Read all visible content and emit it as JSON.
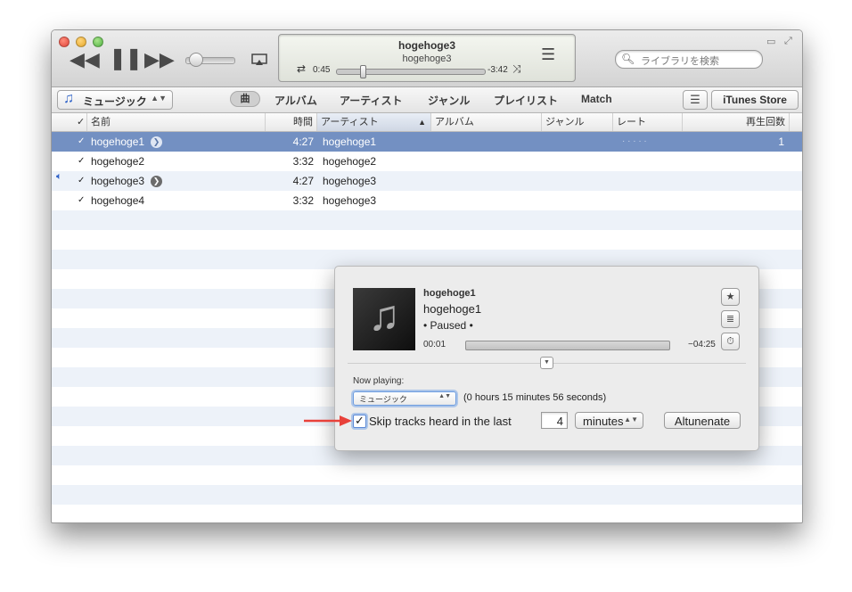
{
  "player": {
    "now_title": "hogehoge3",
    "now_artist": "hogehoge3",
    "elapsed": "0:45",
    "remaining": "-3:42",
    "progress": 0.18,
    "volume": 0.15
  },
  "search": {
    "placeholder": "ライブラリを検索"
  },
  "nav": {
    "library": "ミュージック",
    "songs_pill": "曲",
    "items": [
      "アルバム",
      "アーティスト",
      "ジャンル",
      "プレイリスト",
      "Match"
    ],
    "store": "iTunes Store"
  },
  "columns": {
    "check": "✓",
    "name": "名前",
    "time": "時間",
    "artist": "アーティスト",
    "album": "アルバム",
    "genre": "ジャンル",
    "rating": "レート",
    "plays": "再生回数"
  },
  "tracks": [
    {
      "name": "hogehoge1",
      "time": "4:27",
      "artist": "hogehoge1",
      "rating": "· · · · ·",
      "plays": "1"
    },
    {
      "name": "hogehoge2",
      "time": "3:32",
      "artist": "hogehoge2",
      "rating": "",
      "plays": ""
    },
    {
      "name": "hogehoge3",
      "time": "4:27",
      "artist": "hogehoge3",
      "rating": "",
      "plays": ""
    },
    {
      "name": "hogehoge4",
      "time": "3:32",
      "artist": "hogehoge3",
      "rating": "",
      "plays": ""
    }
  ],
  "popup": {
    "title": "hogehoge1",
    "artist": "hogehoge1",
    "state": "• Paused •",
    "elapsed": "00:01",
    "remaining": "−04:25",
    "progress": 0.0,
    "now_playing_label": "Now playing:",
    "playlist": "ミュージック",
    "duration": "(0 hours 15 minutes 56 seconds)",
    "skip_label": "Skip tracks heard in the last",
    "skip_checked": true,
    "skip_value": "4",
    "unit": "minutes",
    "button": "Altunenate"
  },
  "colors": {
    "selection": "#7390c2",
    "alt_row": "#edf2f9",
    "accent_arrow": "#e8413a"
  }
}
